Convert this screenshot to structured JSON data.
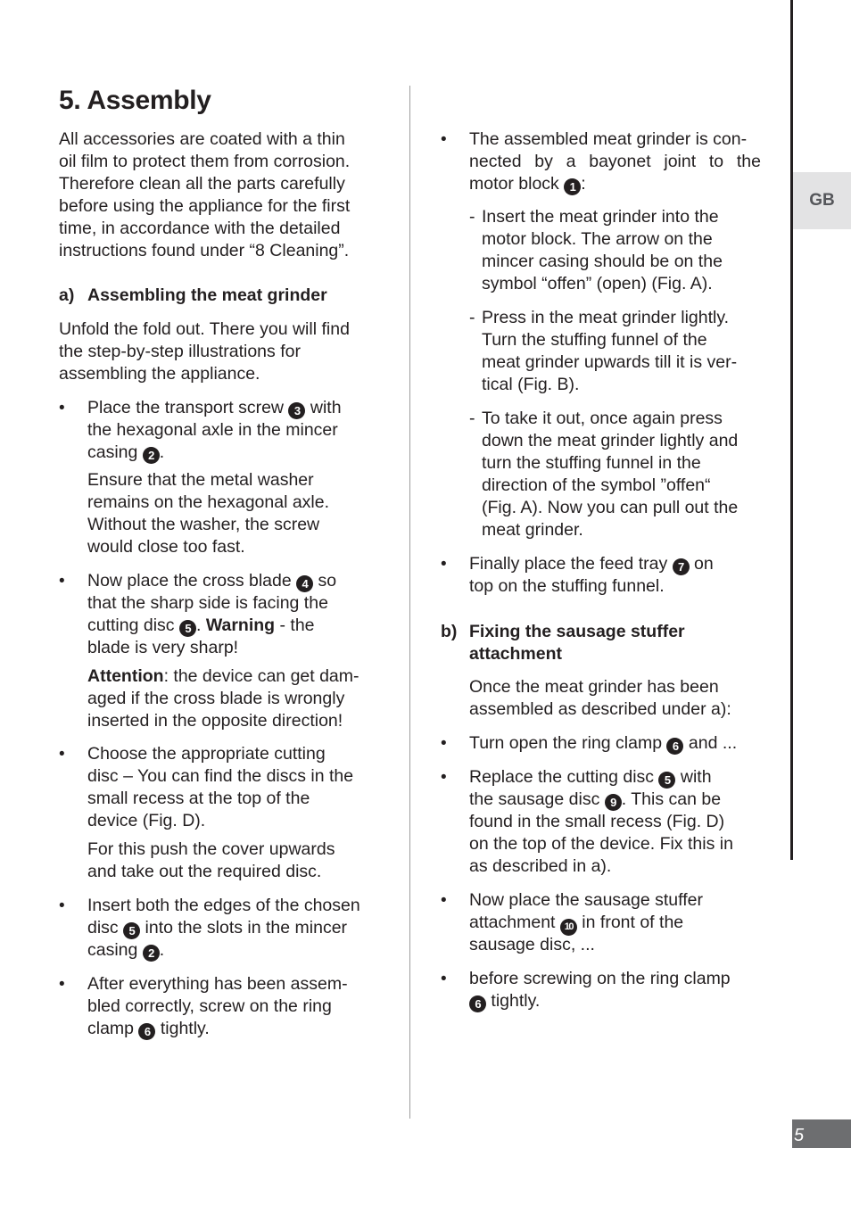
{
  "page": {
    "title": "5. Assembly",
    "language_tab": "GB",
    "page_number": "5"
  },
  "intro": [
    "All accessories are coated with a thin",
    "oil film to protect them from corrosion.",
    "Therefore clean all the parts carefully",
    "before using the appliance for the first",
    "time, in accordance with the detailed",
    "instructions found under “8 Cleaning”."
  ],
  "section_a": {
    "marker": "a)",
    "heading": "Assembling the meat grinder",
    "intro": [
      "Unfold the fold out. There you will find",
      "the step-by-step illustrations for",
      "assembling the appliance."
    ],
    "bullet_char": "•",
    "item1": {
      "l1_a": "Place the transport screw ",
      "n1": "3",
      "l1_b": " with",
      "l2": "the hexagonal axle in the mincer",
      "l3_a": "casing ",
      "n2": "2",
      "l3_b": ".",
      "note": [
        "Ensure that the metal washer",
        "remains on the hexagonal axle.",
        "Without the washer, the screw",
        "would close too fast."
      ]
    },
    "item2": {
      "l1_a": "Now place the cross blade ",
      "n1": "4",
      "l1_b": " so",
      "l2": "that the sharp side is facing the",
      "l3_a": "cutting disc ",
      "n2": "5",
      "l3_b": ". ",
      "l3_bold": "Warning",
      "l3_c": " - the",
      "l4": "blade is very sharp!",
      "note_bold": "Attention",
      "note_l1": ": the device can get dam-",
      "note_rest": [
        "aged if the cross blade is wrongly",
        "inserted in the opposite direction!"
      ]
    },
    "item3": {
      "lines": [
        "Choose the appropriate cutting",
        "disc – You can find the discs in the",
        "small recess at the top of the",
        "device (Fig. D)."
      ],
      "note": [
        "For this push the cover upwards",
        "and take out the required disc."
      ]
    },
    "item4": {
      "l1": "Insert both the edges of the chosen",
      "l2_a": "disc ",
      "n1": "5",
      "l2_b": " into the slots in the mincer",
      "l3_a": "casing ",
      "n2": "2",
      "l3_b": "."
    },
    "item5": {
      "l1": "After everything has been assem-",
      "l2": "bled correctly, screw on the ring",
      "l3_a": "clamp ",
      "n1": "6",
      "l3_b": " tightly."
    },
    "item6": {
      "l1": "The assembled meat grinder is con-",
      "l2": "nected by a bayonet joint to the",
      "l3_a": "motor block ",
      "n1": "1",
      "l3_b": ":"
    },
    "sub_steps": [
      {
        "dash": "- ",
        "lines": [
          "Insert the meat grinder into the",
          "motor block. The arrow on the",
          "mincer casing should be on the",
          "symbol “offen” (open) (Fig. A)."
        ]
      },
      {
        "dash": "- ",
        "lines": [
          "Press in the meat grinder lightly.",
          "Turn the stuffing funnel of the",
          "meat grinder upwards till it is ver-",
          "tical (Fig. B)."
        ]
      },
      {
        "dash": "- ",
        "lines": [
          "To take it out, once again press",
          "down the meat grinder lightly and",
          "turn the stuffing funnel in the",
          "direction of the symbol ”offen“",
          "(Fig. A). Now you can pull out the",
          "meat grinder."
        ]
      }
    ],
    "item7": {
      "l1_a": "Finally place the feed tray ",
      "n1": "7",
      "l1_b": " on",
      "l2": "top on the stuffing funnel."
    }
  },
  "section_b": {
    "marker": "b)",
    "heading": [
      "Fixing the sausage stuffer",
      "attachment"
    ],
    "intro": [
      "Once the meat grinder has been",
      "assembled as described under a):"
    ],
    "item1": {
      "l1_a": "Turn open the ring clamp ",
      "n1": "6",
      "l1_b": " and ..."
    },
    "item2": {
      "l1_a": "Replace the cutting disc ",
      "n1": "5",
      "l1_b": " with",
      "l2_a": "the sausage disc ",
      "n2": "9",
      "l2_b": ". This can be",
      "l3": "found in the small recess (Fig.  D)",
      "l4": "on the top of the device. Fix this in",
      "l5": "as described in a)."
    },
    "item3": {
      "l1": "Now place the sausage stuffer",
      "l2_a": "attachment ",
      "n1": "10",
      "l2_b": " in front of the",
      "l3": "sausage disc, ..."
    },
    "item4": {
      "l1": "before screwing on the ring clamp",
      "n1": "6",
      "l2_b": " tightly."
    }
  }
}
